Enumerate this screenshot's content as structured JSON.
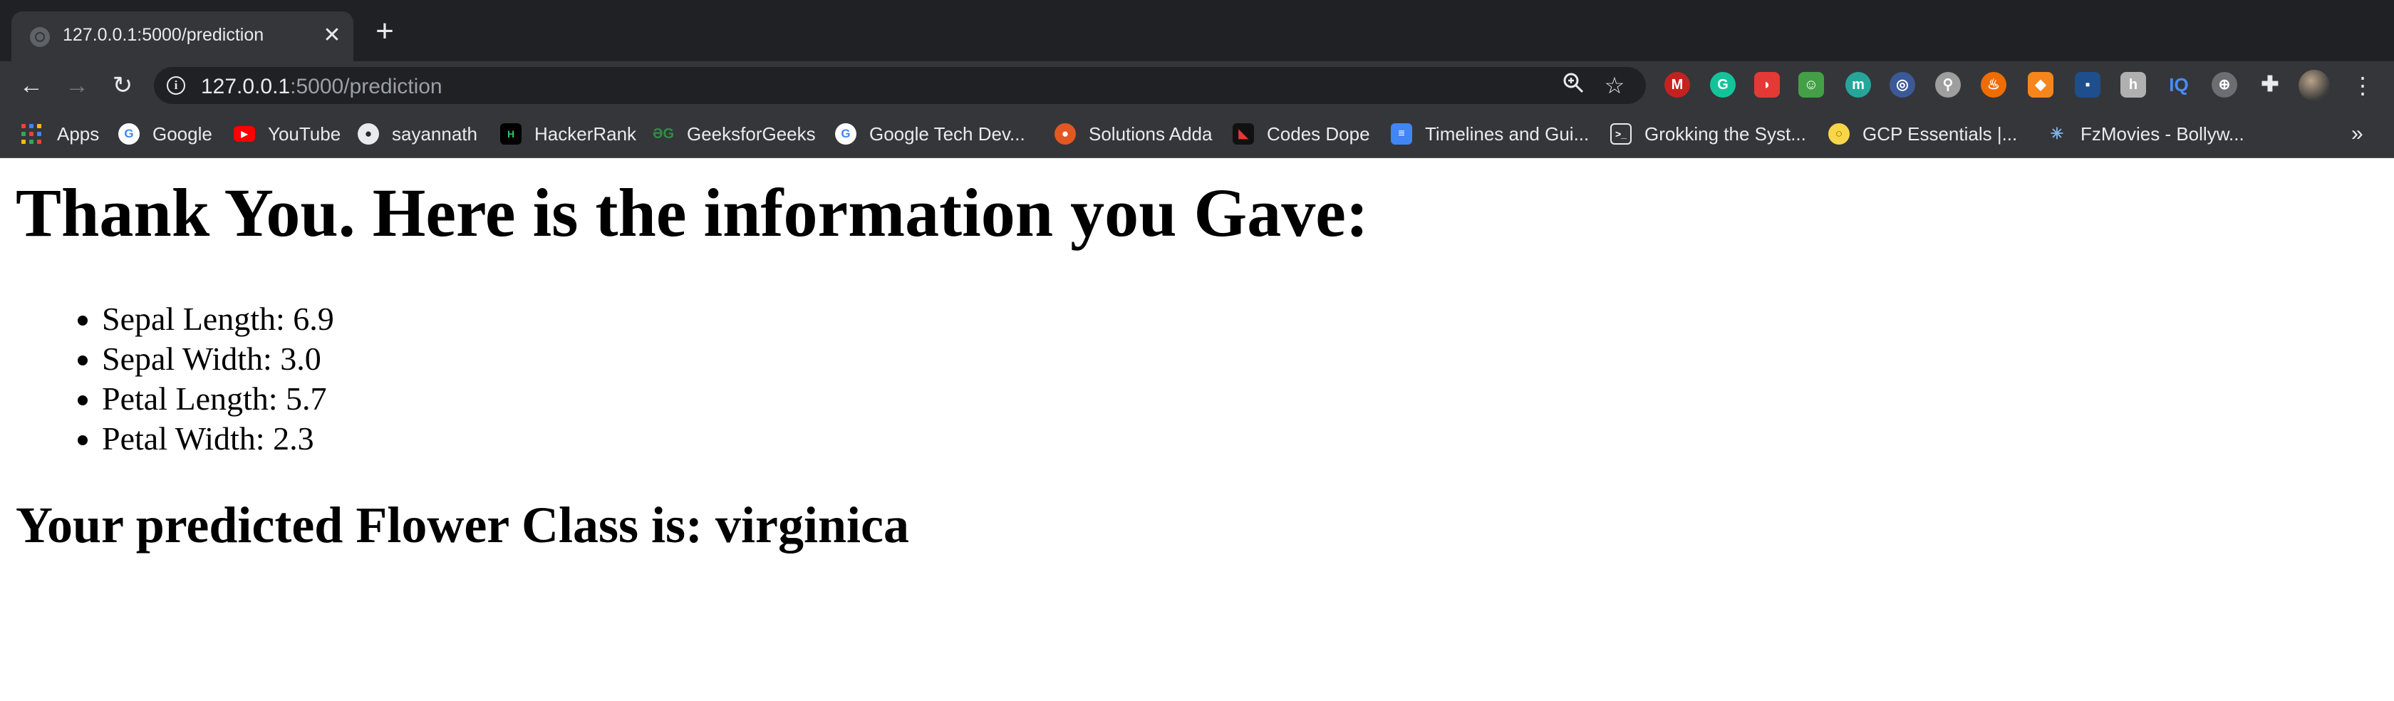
{
  "browser": {
    "tab": {
      "title": "127.0.0.1:5000/prediction",
      "close_glyph": "✕"
    },
    "new_tab_glyph": "+",
    "url_host": "127.0.0.1",
    "url_path": ":5000/prediction",
    "bookmarks": [
      {
        "label": "Apps",
        "icon": "apps-grid-icon"
      },
      {
        "label": "Google",
        "icon": "google-icon"
      },
      {
        "label": "YouTube",
        "icon": "youtube-icon"
      },
      {
        "label": "sayannath",
        "icon": "github-icon"
      },
      {
        "label": "HackerRank",
        "icon": "hackerrank-icon"
      },
      {
        "label": "GeeksforGeeks",
        "icon": "geeksforgeeks-icon"
      },
      {
        "label": "Google Tech Dev...",
        "icon": "google-icon"
      },
      {
        "label": "Solutions Adda",
        "icon": "solutions-adda-icon"
      },
      {
        "label": "Codes Dope",
        "icon": "codes-dope-icon"
      },
      {
        "label": "Timelines and Gui...",
        "icon": "google-docs-icon"
      },
      {
        "label": "Grokking the Syst...",
        "icon": "terminal-icon"
      },
      {
        "label": "GCP Essentials |...",
        "icon": "gcp-essentials-icon"
      },
      {
        "label": "FzMovies - Bollyw...",
        "icon": "fzmovies-icon"
      }
    ],
    "bookmarks_overflow_glyph": "»",
    "colors": {
      "tabstrip": "#202124",
      "toolbar": "#35363a",
      "omnibox": "#202124"
    }
  },
  "page": {
    "heading": "Thank You. Here is the information you Gave:",
    "details": [
      "Sepal Length: 6.9",
      "Sepal Width: 3.0",
      "Petal Length: 5.7",
      "Petal Width: 2.3"
    ],
    "result": "Your predicted Flower Class is: virginica"
  }
}
